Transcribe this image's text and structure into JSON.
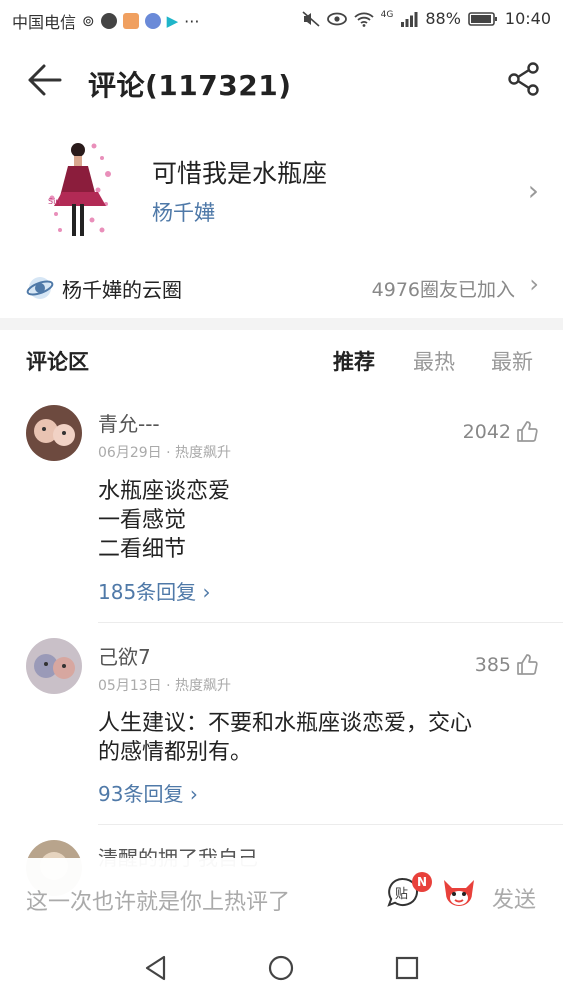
{
  "status_bar": {
    "carrier": "中国电信",
    "battery_percent": "88%",
    "time": "10:40",
    "network": "4G"
  },
  "header": {
    "title": "评论(117321)"
  },
  "song": {
    "title": "可惜我是水瓶座",
    "artist": "杨千嬅"
  },
  "circle": {
    "name": "杨千嬅的云圈",
    "member_count": "4976圈友已加入"
  },
  "comment_area": {
    "label": "评论区",
    "sort_tabs": [
      "推荐",
      "最热",
      "最新"
    ]
  },
  "comments": [
    {
      "username": "青允---",
      "date": "06月29日",
      "tag": "· 热度飙升",
      "likes": "2042",
      "lines": [
        "水瓶座谈恋爱",
        "一看感觉",
        "二看细节"
      ],
      "replies": "185条回复"
    },
    {
      "username": "己欲7",
      "date": "05月13日",
      "tag": "· 热度飙升",
      "likes": "385",
      "lines": [
        "人生建议：不要和水瓶座谈恋爱，交心",
        "的感情都别有。"
      ],
      "replies": "93条回复"
    },
    {
      "username": "清醒的拥了我自己"
    }
  ],
  "input_bar": {
    "placeholder": "这一次也许就是你上热评了",
    "badge": "N",
    "tie_label": "贴",
    "send_label": "发送"
  },
  "colors": {
    "link_blue": "#4f79a8",
    "badge_red": "#e8413b"
  }
}
